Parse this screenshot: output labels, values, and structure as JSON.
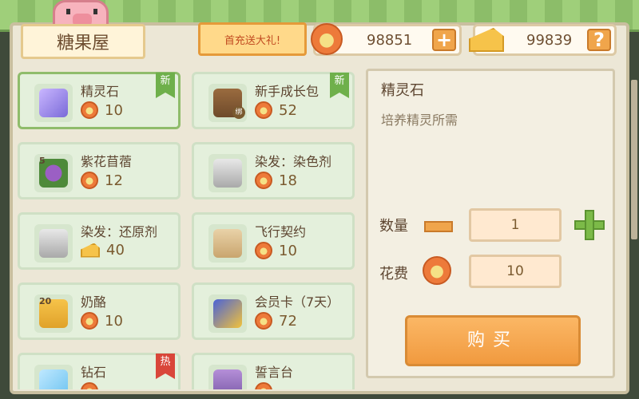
{
  "header": {
    "shop_title": "糖果屋",
    "promo": "首充送大礼!",
    "gem_balance": "98851",
    "cheese_balance": "99839",
    "add_symbol": "+",
    "help_symbol": "?"
  },
  "items": [
    {
      "name": "精灵石",
      "price": "10",
      "currency": "gem",
      "badge": "新",
      "badge_type": "new",
      "icon": "gem-icon",
      "selected": true
    },
    {
      "name": "新手成长包",
      "price": "52",
      "currency": "gem",
      "badge": "新",
      "badge_type": "new",
      "icon": "backpack-icon",
      "tag": "绑"
    },
    {
      "name": "紫花苜蓿",
      "price": "12",
      "currency": "gem",
      "icon": "flower-icon",
      "count": "5"
    },
    {
      "name": "染发：染色剂",
      "price": "18",
      "currency": "gem",
      "icon": "bottle-icon"
    },
    {
      "name": "染发：还原剂",
      "price": "40",
      "currency": "cheese",
      "icon": "bottle-icon"
    },
    {
      "name": "飞行契约",
      "price": "10",
      "currency": "gem",
      "icon": "scroll-icon"
    },
    {
      "name": "奶酪",
      "price": "10",
      "currency": "gem",
      "icon": "cheese-icon",
      "count": "20"
    },
    {
      "name": "会员卡（7天）",
      "price": "72",
      "currency": "gem",
      "icon": "vip-card-icon"
    },
    {
      "name": "钻石",
      "price": "",
      "currency": "gem",
      "badge": "热",
      "badge_type": "hot",
      "icon": "diamond-icon"
    },
    {
      "name": "誓言台",
      "price": "",
      "currency": "gem",
      "icon": "altar-icon"
    }
  ],
  "detail": {
    "name": "精灵石",
    "description": "培养精灵所需",
    "quantity_label": "数量",
    "quantity": "1",
    "cost_label": "花费",
    "cost": "10",
    "buy_label": "购买"
  },
  "colors": {
    "card_bg": "#e4f0dc",
    "accent_orange": "#f19a3f",
    "accent_green": "#7cba48",
    "text_brown": "#5d4530"
  }
}
